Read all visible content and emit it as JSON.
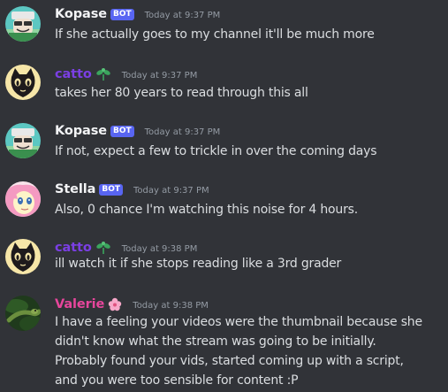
{
  "colors": {
    "background": "#313338",
    "bot_badge": "#5865f2",
    "catto_name": "#7b3fe4",
    "valerie_name": "#e7469c",
    "timestamp": "#949ba4",
    "message_text": "#dbdee1"
  },
  "messages": [
    {
      "username": "Kopase",
      "badge": "BOT",
      "timestamp": "Today at 9:37 PM",
      "lines": [
        "If she actually goes to my channel it'll be much more"
      ]
    },
    {
      "username": "catto",
      "role_icon": "sprout-icon",
      "timestamp": "Today at 9:37 PM",
      "lines": [
        "takes her 80 years to read through this all"
      ]
    },
    {
      "username": "Kopase",
      "badge": "BOT",
      "timestamp": "Today at 9:37 PM",
      "lines": [
        "If not, expect a few to trickle in over the coming days"
      ]
    },
    {
      "username": "Stella",
      "badge": "BOT",
      "timestamp": "Today at 9:37 PM",
      "lines": [
        "Also, 0 chance I'm watching this noise for 4 hours."
      ]
    },
    {
      "username": "catto",
      "role_icon": "sprout-icon",
      "timestamp": "Today at 9:38 PM",
      "lines": [
        "ill watch it if she stops reading like a 3rd grader"
      ]
    },
    {
      "username": "Valerie",
      "role_icon": "flower-icon",
      "timestamp": "Today at 9:38 PM",
      "lines": [
        "I have a feeling your videos were the thumbnail because she",
        "didn't know what the stream was going to be initially.",
        "Probably found your vids, started coming up with a script,",
        "and you were too sensible for content :P"
      ]
    }
  ]
}
